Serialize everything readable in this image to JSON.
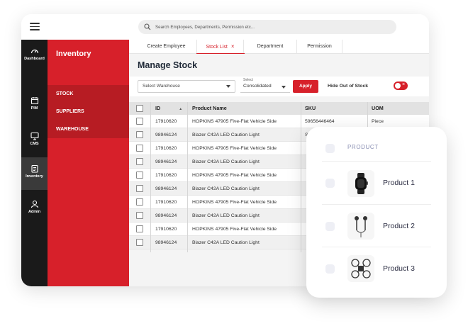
{
  "search": {
    "placeholder": "Search Employees, Departments, Permission etc..."
  },
  "iconbar": [
    {
      "label": "Dashboard",
      "icon": "gauge-icon"
    },
    {
      "label": "PIM",
      "icon": "calendar-icon"
    },
    {
      "label": "CMS",
      "icon": "monitor-icon"
    },
    {
      "label": "Inventory",
      "icon": "clipboard-icon",
      "active": true
    },
    {
      "label": "Admin",
      "icon": "user-icon"
    }
  ],
  "sidebar": {
    "title": "Inventory",
    "items": [
      {
        "label": "STOCK",
        "active": true
      },
      {
        "label": "SUPPLIERS"
      },
      {
        "label": "WAREHOUSE"
      }
    ]
  },
  "tabs": [
    {
      "label": "Create Employee"
    },
    {
      "label": "Stock List",
      "active": true,
      "close": "×"
    },
    {
      "label": "Department"
    },
    {
      "label": "Permission"
    }
  ],
  "page": {
    "title": "Manage Stock"
  },
  "filters": {
    "warehouse": "Select Warehouse",
    "consolidated_label": "Select",
    "consolidated_value": "Consolidated",
    "apply": "Apply",
    "hide_out_of_stock": "Hide Out of Stock"
  },
  "table": {
    "columns": [
      "ID",
      "Product Name",
      "SKU",
      "UOM"
    ],
    "sort_indicator": "▲",
    "rows": [
      {
        "id": "17910620",
        "name": "HOPKINS 47905 Five-Flat Vehicle Side",
        "sku": "59656446464",
        "uom": "Piece"
      },
      {
        "id": "98946124",
        "name": "Blazer C42A LED Caution Light",
        "sku": "S",
        "uom": ""
      },
      {
        "id": "17910620",
        "name": "HOPKINS 47905 Five-Flat Vehicle Side",
        "sku": "",
        "uom": ""
      },
      {
        "id": "98946124",
        "name": "Blazer C42A LED Caution Light",
        "sku": "",
        "uom": ""
      },
      {
        "id": "17910620",
        "name": "HOPKINS 47905 Five-Flat Vehicle Side",
        "sku": "",
        "uom": ""
      },
      {
        "id": "98946124",
        "name": "Blazer C42A LED Caution Light",
        "sku": "",
        "uom": ""
      },
      {
        "id": "17910620",
        "name": "HOPKINS 47905 Five-Flat Vehicle Side",
        "sku": "",
        "uom": ""
      },
      {
        "id": "98946124",
        "name": "Blazer C42A LED Caution Light",
        "sku": "",
        "uom": ""
      },
      {
        "id": "17910620",
        "name": "HOPKINS 47905 Five-Flat Vehicle Side",
        "sku": "",
        "uom": ""
      },
      {
        "id": "98946124",
        "name": "Blazer C42A LED Caution Light",
        "sku": "",
        "uom": ""
      }
    ]
  },
  "product_card": {
    "header": "PRODUCT",
    "items": [
      {
        "name": "Product 1",
        "icon": "smartwatch-icon"
      },
      {
        "name": "Product 2",
        "icon": "earphones-icon"
      },
      {
        "name": "Product 3",
        "icon": "drone-icon"
      }
    ]
  },
  "colors": {
    "accent": "#d7202a",
    "accent_dark": "#b71c23",
    "dark_bar": "#1a1a1a"
  }
}
